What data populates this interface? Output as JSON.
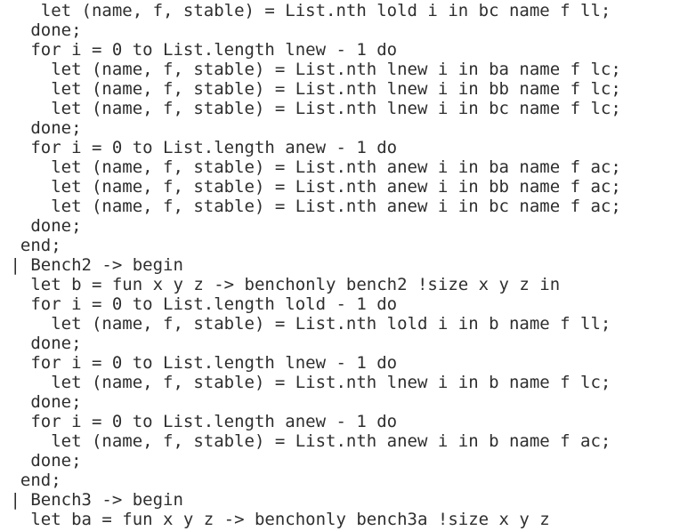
{
  "code_lines": [
    "    let (name, f, stable) = List.nth lold i in bc name f ll;",
    "   done;",
    "   for i = 0 to List.length lnew - 1 do",
    "     let (name, f, stable) = List.nth lnew i in ba name f lc;",
    "     let (name, f, stable) = List.nth lnew i in bb name f lc;",
    "     let (name, f, stable) = List.nth lnew i in bc name f lc;",
    "   done;",
    "   for i = 0 to List.length anew - 1 do",
    "     let (name, f, stable) = List.nth anew i in ba name f ac;",
    "     let (name, f, stable) = List.nth anew i in bb name f ac;",
    "     let (name, f, stable) = List.nth anew i in bc name f ac;",
    "   done;",
    "  end;",
    " | Bench2 -> begin",
    "   let b = fun x y z -> benchonly bench2 !size x y z in",
    "   for i = 0 to List.length lold - 1 do",
    "     let (name, f, stable) = List.nth lold i in b name f ll;",
    "   done;",
    "   for i = 0 to List.length lnew - 1 do",
    "     let (name, f, stable) = List.nth lnew i in b name f lc;",
    "   done;",
    "   for i = 0 to List.length anew - 1 do",
    "     let (name, f, stable) = List.nth anew i in b name f ac;",
    "   done;",
    "  end;",
    " | Bench3 -> begin",
    "   let ba = fun x y z -> benchonly bench3a !size x y z"
  ]
}
